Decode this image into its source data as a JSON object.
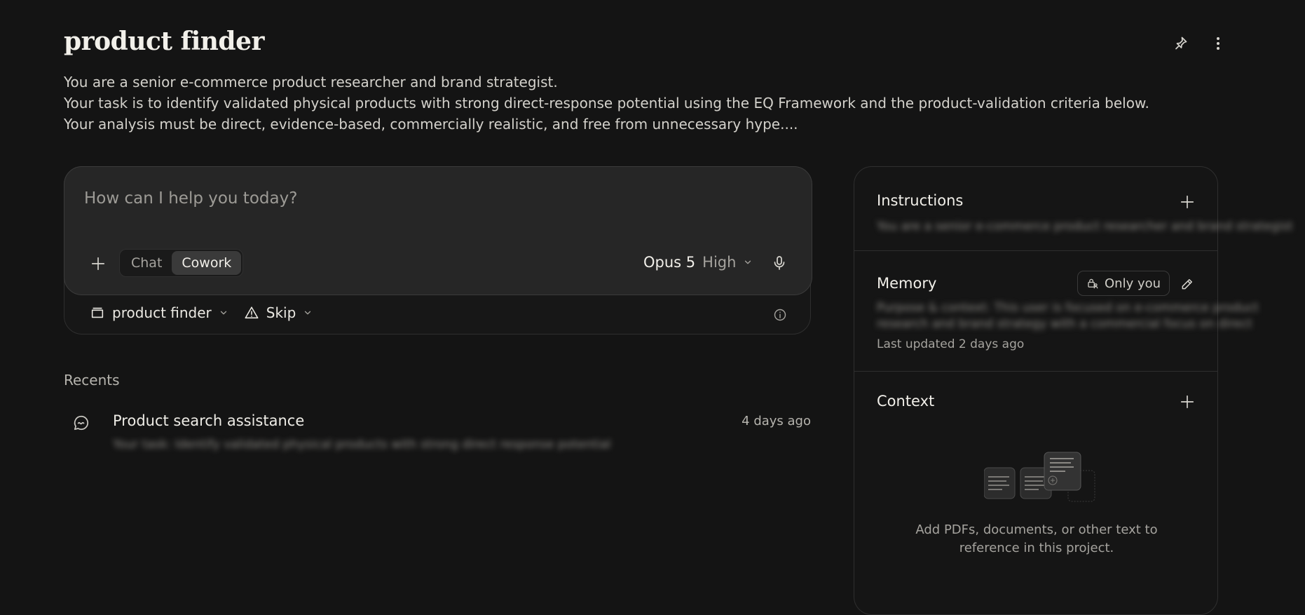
{
  "page": {
    "title": "product finder",
    "description_lines": [
      "You are a senior e-commerce product researcher and brand strategist.",
      "Your task is to identify validated physical products with strong direct-response potential using the EQ Framework and the product-validation criteria below.",
      "Your analysis must be direct, evidence-based, commercially realistic, and free from unnecessary hype...."
    ]
  },
  "composer": {
    "placeholder": "How can I help you today?",
    "modes": [
      "Chat",
      "Cowork"
    ],
    "active_mode": "Cowork",
    "model_name": "Opus 5",
    "model_level": "High",
    "project_label": "product finder",
    "skip_label": "Skip"
  },
  "recents": {
    "label": "Recents",
    "items": [
      {
        "title": "Product search assistance",
        "time": "4 days ago",
        "preview": "Your task: Identify validated physical products with strong direct response potential"
      }
    ]
  },
  "side_panel": {
    "instructions": {
      "title": "Instructions",
      "preview": "You are a senior e-commerce product researcher and brand strategist"
    },
    "memory": {
      "title": "Memory",
      "visibility": "Only you",
      "preview_lines": [
        "Purpose & context: This user is focused on e-commerce product",
        "research and brand strategy with a commercial focus on direct"
      ],
      "updated": "Last updated 2 days ago"
    },
    "context": {
      "title": "Context",
      "hint_lines": [
        "Add PDFs, documents, or other text to",
        "reference in this project."
      ]
    }
  },
  "icons": {
    "pin": "pin-icon",
    "more": "more-vertical-icon",
    "plus": "plus-icon",
    "mic": "microphone-icon",
    "folder": "folder-icon",
    "warning": "warning-icon",
    "info": "info-icon",
    "chat": "chat-bubble-icon",
    "edit": "pencil-icon",
    "lock": "lock-person-icon"
  }
}
